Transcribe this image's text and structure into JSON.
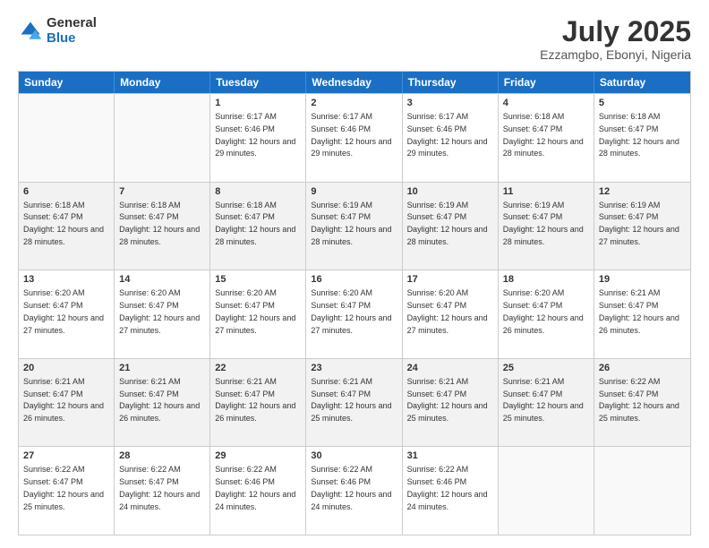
{
  "logo": {
    "general": "General",
    "blue": "Blue"
  },
  "title": "July 2025",
  "location": "Ezzamgbo, Ebonyi, Nigeria",
  "days": [
    "Sunday",
    "Monday",
    "Tuesday",
    "Wednesday",
    "Thursday",
    "Friday",
    "Saturday"
  ],
  "weeks": [
    [
      {
        "day": "",
        "info": ""
      },
      {
        "day": "",
        "info": ""
      },
      {
        "day": "1",
        "info": "Sunrise: 6:17 AM\nSunset: 6:46 PM\nDaylight: 12 hours and 29 minutes."
      },
      {
        "day": "2",
        "info": "Sunrise: 6:17 AM\nSunset: 6:46 PM\nDaylight: 12 hours and 29 minutes."
      },
      {
        "day": "3",
        "info": "Sunrise: 6:17 AM\nSunset: 6:46 PM\nDaylight: 12 hours and 29 minutes."
      },
      {
        "day": "4",
        "info": "Sunrise: 6:18 AM\nSunset: 6:47 PM\nDaylight: 12 hours and 28 minutes."
      },
      {
        "day": "5",
        "info": "Sunrise: 6:18 AM\nSunset: 6:47 PM\nDaylight: 12 hours and 28 minutes."
      }
    ],
    [
      {
        "day": "6",
        "info": "Sunrise: 6:18 AM\nSunset: 6:47 PM\nDaylight: 12 hours and 28 minutes."
      },
      {
        "day": "7",
        "info": "Sunrise: 6:18 AM\nSunset: 6:47 PM\nDaylight: 12 hours and 28 minutes."
      },
      {
        "day": "8",
        "info": "Sunrise: 6:18 AM\nSunset: 6:47 PM\nDaylight: 12 hours and 28 minutes."
      },
      {
        "day": "9",
        "info": "Sunrise: 6:19 AM\nSunset: 6:47 PM\nDaylight: 12 hours and 28 minutes."
      },
      {
        "day": "10",
        "info": "Sunrise: 6:19 AM\nSunset: 6:47 PM\nDaylight: 12 hours and 28 minutes."
      },
      {
        "day": "11",
        "info": "Sunrise: 6:19 AM\nSunset: 6:47 PM\nDaylight: 12 hours and 28 minutes."
      },
      {
        "day": "12",
        "info": "Sunrise: 6:19 AM\nSunset: 6:47 PM\nDaylight: 12 hours and 27 minutes."
      }
    ],
    [
      {
        "day": "13",
        "info": "Sunrise: 6:20 AM\nSunset: 6:47 PM\nDaylight: 12 hours and 27 minutes."
      },
      {
        "day": "14",
        "info": "Sunrise: 6:20 AM\nSunset: 6:47 PM\nDaylight: 12 hours and 27 minutes."
      },
      {
        "day": "15",
        "info": "Sunrise: 6:20 AM\nSunset: 6:47 PM\nDaylight: 12 hours and 27 minutes."
      },
      {
        "day": "16",
        "info": "Sunrise: 6:20 AM\nSunset: 6:47 PM\nDaylight: 12 hours and 27 minutes."
      },
      {
        "day": "17",
        "info": "Sunrise: 6:20 AM\nSunset: 6:47 PM\nDaylight: 12 hours and 27 minutes."
      },
      {
        "day": "18",
        "info": "Sunrise: 6:20 AM\nSunset: 6:47 PM\nDaylight: 12 hours and 26 minutes."
      },
      {
        "day": "19",
        "info": "Sunrise: 6:21 AM\nSunset: 6:47 PM\nDaylight: 12 hours and 26 minutes."
      }
    ],
    [
      {
        "day": "20",
        "info": "Sunrise: 6:21 AM\nSunset: 6:47 PM\nDaylight: 12 hours and 26 minutes."
      },
      {
        "day": "21",
        "info": "Sunrise: 6:21 AM\nSunset: 6:47 PM\nDaylight: 12 hours and 26 minutes."
      },
      {
        "day": "22",
        "info": "Sunrise: 6:21 AM\nSunset: 6:47 PM\nDaylight: 12 hours and 26 minutes."
      },
      {
        "day": "23",
        "info": "Sunrise: 6:21 AM\nSunset: 6:47 PM\nDaylight: 12 hours and 25 minutes."
      },
      {
        "day": "24",
        "info": "Sunrise: 6:21 AM\nSunset: 6:47 PM\nDaylight: 12 hours and 25 minutes."
      },
      {
        "day": "25",
        "info": "Sunrise: 6:21 AM\nSunset: 6:47 PM\nDaylight: 12 hours and 25 minutes."
      },
      {
        "day": "26",
        "info": "Sunrise: 6:22 AM\nSunset: 6:47 PM\nDaylight: 12 hours and 25 minutes."
      }
    ],
    [
      {
        "day": "27",
        "info": "Sunrise: 6:22 AM\nSunset: 6:47 PM\nDaylight: 12 hours and 25 minutes."
      },
      {
        "day": "28",
        "info": "Sunrise: 6:22 AM\nSunset: 6:47 PM\nDaylight: 12 hours and 24 minutes."
      },
      {
        "day": "29",
        "info": "Sunrise: 6:22 AM\nSunset: 6:46 PM\nDaylight: 12 hours and 24 minutes."
      },
      {
        "day": "30",
        "info": "Sunrise: 6:22 AM\nSunset: 6:46 PM\nDaylight: 12 hours and 24 minutes."
      },
      {
        "day": "31",
        "info": "Sunrise: 6:22 AM\nSunset: 6:46 PM\nDaylight: 12 hours and 24 minutes."
      },
      {
        "day": "",
        "info": ""
      },
      {
        "day": "",
        "info": ""
      }
    ]
  ]
}
